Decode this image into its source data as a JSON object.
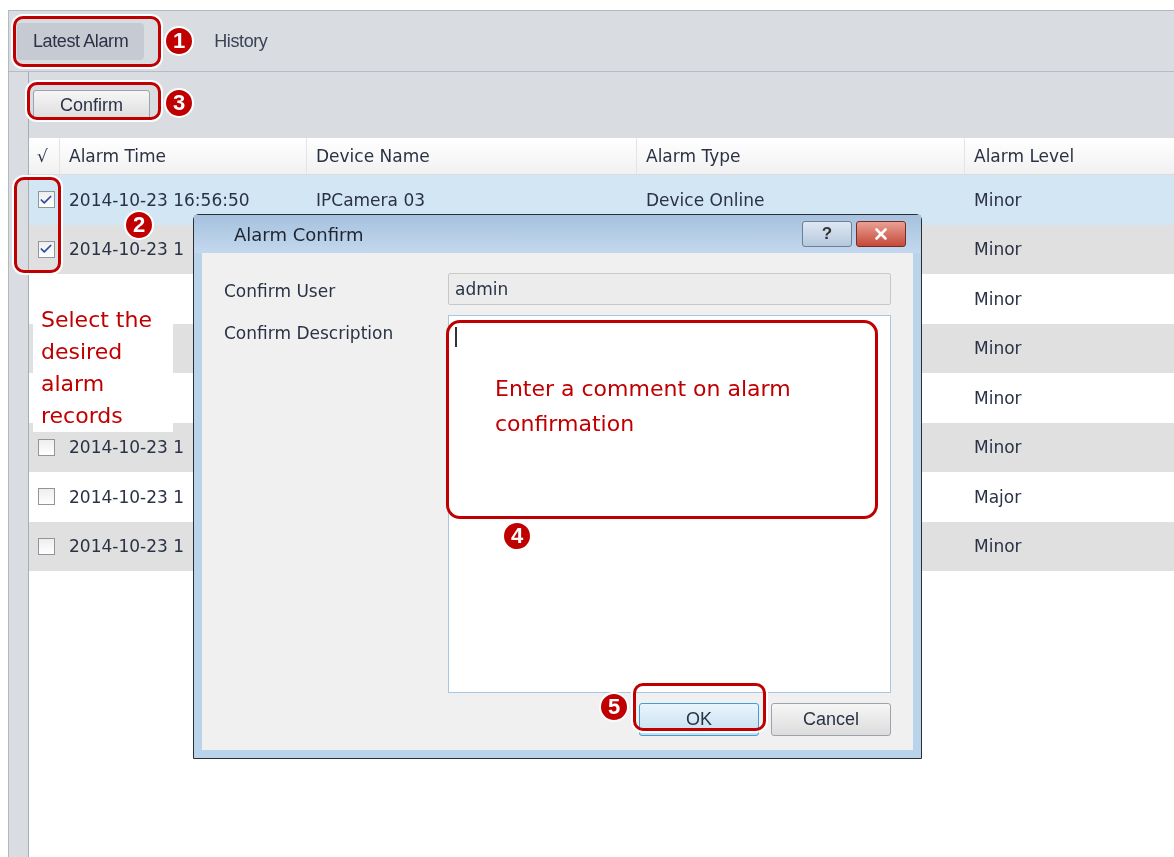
{
  "tabs": [
    {
      "label": "Latest Alarm",
      "selected": true
    },
    {
      "label": "History",
      "selected": false
    }
  ],
  "toolbar": {
    "confirm_button": "Confirm"
  },
  "table": {
    "columns": [
      "√",
      "Alarm Time",
      "Device Name",
      "Alarm Type",
      "Alarm Level"
    ],
    "rows": [
      {
        "checked": true,
        "selected": true,
        "time": "2014-10-23 16:56:50",
        "device": "IPCamera 03",
        "type": "Device Online",
        "level_text": "Minor"
      },
      {
        "checked": true,
        "selected": false,
        "time": "2014-10-23 1",
        "level_text": "Minor"
      },
      {
        "selected": false,
        "level_text": "Minor"
      },
      {
        "selected": false,
        "level_text": "Minor"
      },
      {
        "selected": false,
        "level_text": "Minor"
      },
      {
        "checked": false,
        "selected": false,
        "time": "2014-10-23 1",
        "level_text": "Minor"
      },
      {
        "checked": false,
        "selected": false,
        "time": "2014-10-23 1",
        "level_text": "Major"
      },
      {
        "checked": false,
        "selected": false,
        "time": "2014-10-23 1",
        "level_text": "Minor"
      }
    ]
  },
  "dialog": {
    "title": "Alarm Confirm",
    "help_button": "?",
    "fields": [
      {
        "kind": "text",
        "label": "Confirm User",
        "value": "admin"
      },
      {
        "kind": "textarea",
        "label": "Confirm Description"
      }
    ],
    "buttons": [
      {
        "label": "OK",
        "default": true
      },
      {
        "label": "Cancel",
        "default": false
      }
    ]
  },
  "callouts": [
    {
      "number": "1"
    },
    {
      "number": "2"
    },
    {
      "number": "3"
    },
    {
      "number": "4"
    },
    {
      "number": "5"
    }
  ],
  "notes": [
    {
      "text": "Select the desired alarm records"
    },
    {
      "text": "Enter a comment on alarm confirmation"
    }
  ]
}
